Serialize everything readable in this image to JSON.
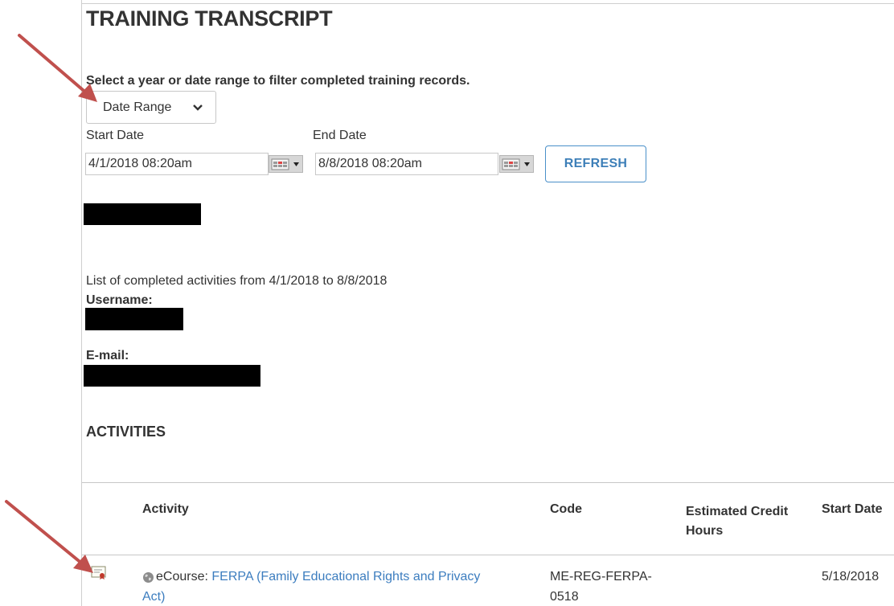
{
  "page": {
    "title": "TRAINING TRANSCRIPT",
    "instruction": "Select a year or date range to filter completed training records."
  },
  "filter": {
    "mode_selected": "Date Range",
    "start_label": "Start Date",
    "start_value": "4/1/2018 08:20am",
    "end_label": "End Date",
    "end_value": "8/8/2018 08:20am",
    "refresh_label": "REFRESH"
  },
  "summary": {
    "line": "List of completed activities from  4/1/2018  to  8/8/2018",
    "username_label": "Username:",
    "email_label": "E-mail:"
  },
  "activities": {
    "heading": "ACTIVITIES",
    "columns": [
      "Activity",
      "Code",
      "Estimated Credit Hours",
      "Start Date"
    ],
    "rows": [
      {
        "type": "eCourse:",
        "title_line1": "FERPA (Family Educational Rights and Privacy",
        "title_line2": "Act)",
        "code_line1": "ME-REG-FERPA-",
        "code_line2": "0518",
        "credit_hours": "",
        "start_date": "5/18/2018"
      }
    ]
  },
  "colors": {
    "accent_blue": "#3c7dbf",
    "annotation_arrow": "#c0504d"
  },
  "icons": [
    "chevron-down-icon",
    "calendar-icon",
    "certificate-icon",
    "globe-icon",
    "annotation-arrow"
  ]
}
